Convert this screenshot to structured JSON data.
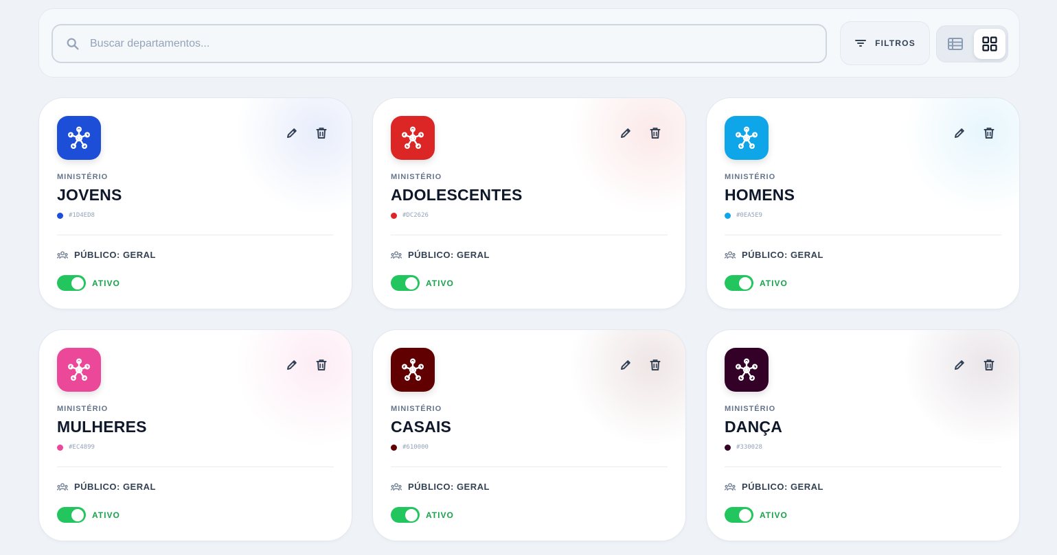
{
  "toolbar": {
    "search_placeholder": "Buscar departamentos...",
    "filters_label": "FILTROS",
    "view_mode": "grid"
  },
  "cards": [
    {
      "category": "MINISTÉRIO",
      "name": "JOVENS",
      "color": "#1D4ED8",
      "hex_label": "#1D4ED8",
      "audience": "PÚBLICO: GERAL",
      "status": "ATIVO",
      "active": true
    },
    {
      "category": "MINISTÉRIO",
      "name": "ADOLESCENTES",
      "color": "#DC2626",
      "hex_label": "#DC2626",
      "audience": "PÚBLICO: GERAL",
      "status": "ATIVO",
      "active": true
    },
    {
      "category": "MINISTÉRIO",
      "name": "HOMENS",
      "color": "#0EA5E9",
      "hex_label": "#0EA5E9",
      "audience": "PÚBLICO: GERAL",
      "status": "ATIVO",
      "active": true
    },
    {
      "category": "MINISTÉRIO",
      "name": "MULHERES",
      "color": "#EC4899",
      "hex_label": "#EC4899",
      "audience": "PÚBLICO: GERAL",
      "status": "ATIVO",
      "active": true
    },
    {
      "category": "MINISTÉRIO",
      "name": "CASAIS",
      "color": "#610000",
      "hex_label": "#610000",
      "audience": "PÚBLICO: GERAL",
      "status": "ATIVO",
      "active": true
    },
    {
      "category": "MINISTÉRIO",
      "name": "DANÇA",
      "color": "#330028",
      "hex_label": "#330028",
      "audience": "PÚBLICO: GERAL",
      "status": "ATIVO",
      "active": true
    }
  ],
  "colors": {
    "toggle_on": "#22c55e",
    "status_text": "#16a34a"
  },
  "icons": {
    "search": "search-icon",
    "filter": "filter-icon",
    "list_view": "list-view-icon",
    "grid_view": "grid-view-icon",
    "department": "network-hub-icon",
    "edit": "pencil-icon",
    "delete": "trash-icon",
    "audience": "group-icon"
  }
}
